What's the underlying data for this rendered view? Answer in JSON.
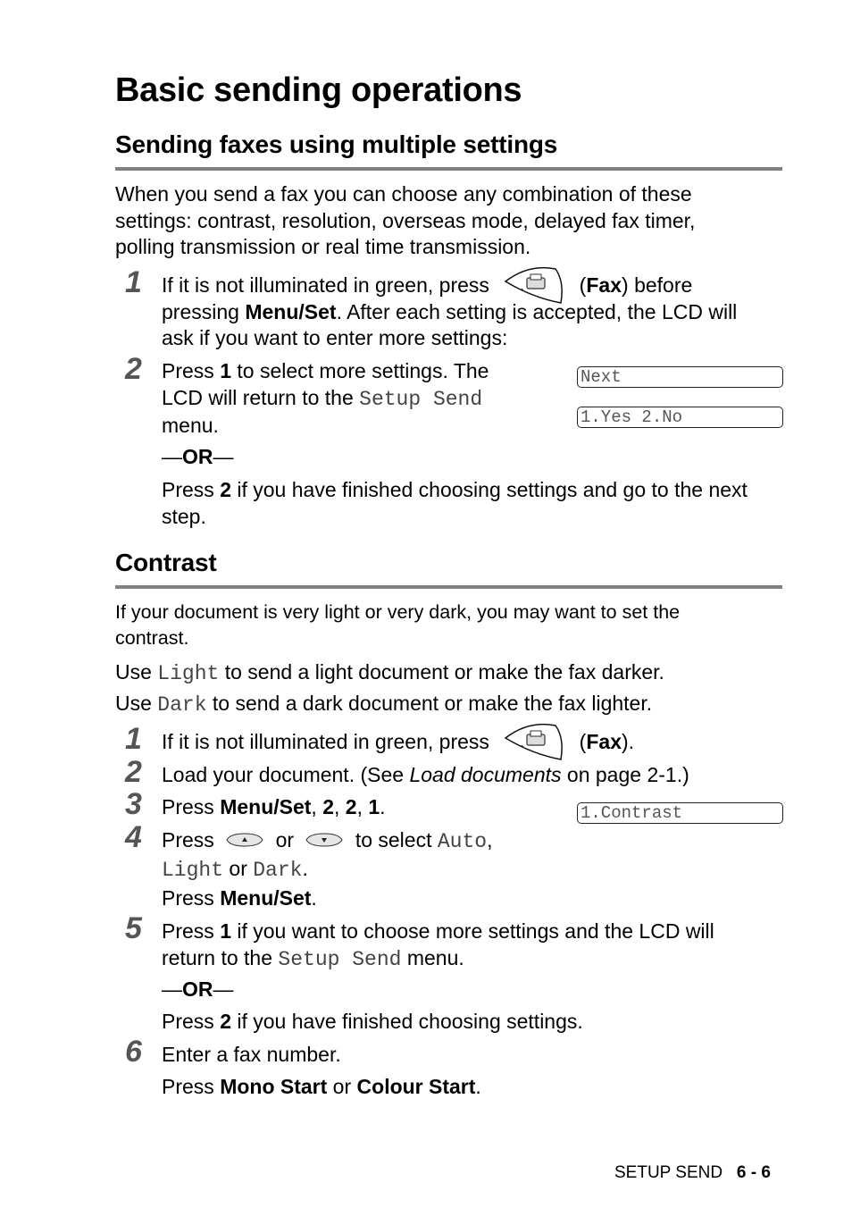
{
  "page": {
    "title": "Basic sending operations",
    "footer": {
      "section": "SETUP SEND",
      "page": "6 - 6"
    }
  },
  "section1": {
    "heading": "Sending faxes using multiple settings",
    "intro": [
      "When you send a fax you can choose any combination of these",
      "settings: contrast, resolution, overseas mode, delayed fax timer,",
      "polling transmission or real time transmission."
    ],
    "steps": [
      {
        "num": "1",
        "line1_pre": "If it is not illuminated in green, press",
        "line1_bold": "Fax",
        "line1_post": "before",
        "line2_pre": "pressing ",
        "line2_bold": "Menu/Set",
        "line2_post": ". After each setting is accepted, the LCD will",
        "line3": "ask if you want to enter more settings:",
        "button_icon": "fax-button-icon"
      },
      {
        "num": "2",
        "line1_pre": "Press ",
        "line1_bold": "1",
        "line1_post": " to select more settings. The",
        "line2_pre": "LCD will return to the ",
        "line2_mono": "Setup Send",
        "line3": "menu.",
        "or": "OR",
        "alt_pre": "Press ",
        "alt_bold": "2",
        "alt_post": " if you have finished choosing settings and go to the next",
        "alt_line2": "step."
      }
    ],
    "lcd": [
      "Next",
      "1.Yes 2.No"
    ]
  },
  "section2": {
    "heading": "Contrast",
    "intro": [
      "If your document is very light or very dark, you may want to set the",
      "contrast."
    ],
    "use_light": {
      "pre": "Use ",
      "mono": "Light",
      "post": " to send a light document or make the fax darker."
    },
    "use_dark": {
      "pre": "Use ",
      "mono": "Dark",
      "post": " to send a dark document or make the fax lighter."
    },
    "steps": [
      {
        "num": "1",
        "pre": "If it is not illuminated in green, press",
        "bold": "Fax",
        "post": ")."
      },
      {
        "num": "2",
        "pre": "Load your document. (See ",
        "italic": "Load documents",
        "post": " on page 2-1.)"
      },
      {
        "num": "3",
        "pre": "Press ",
        "b1": "Menu/Set",
        "s1": ", ",
        "b2": "2",
        "s2": ", ",
        "b3": "2",
        "s3": ", ",
        "b4": "1",
        "post": "."
      },
      {
        "num": "4",
        "pre": "Press",
        "or": "or",
        "post": "to select ",
        "m1": "Auto",
        "comma": ",",
        "m2": "Light",
        "or2": " or ",
        "m3": "Dark",
        "dot": ".",
        "press": "Press ",
        "press_bold": "Menu/Set",
        "press_dot": "."
      },
      {
        "num": "5",
        "pre": "Press ",
        "bold": "1",
        "post": " if you want to choose more settings and the LCD will",
        "line2_pre": "return to the ",
        "line2_mono": "Setup Send",
        "line2_post": " menu.",
        "or": "OR",
        "alt_pre": "Press ",
        "alt_bold": "2",
        "alt_post": " if you have finished choosing settings."
      },
      {
        "num": "6",
        "text": "Enter a fax number.",
        "press": "Press ",
        "b1": "Mono Start",
        "or": " or ",
        "b2": "Colour Start",
        "dot": "."
      }
    ],
    "lcd": [
      "1.Contrast"
    ]
  }
}
